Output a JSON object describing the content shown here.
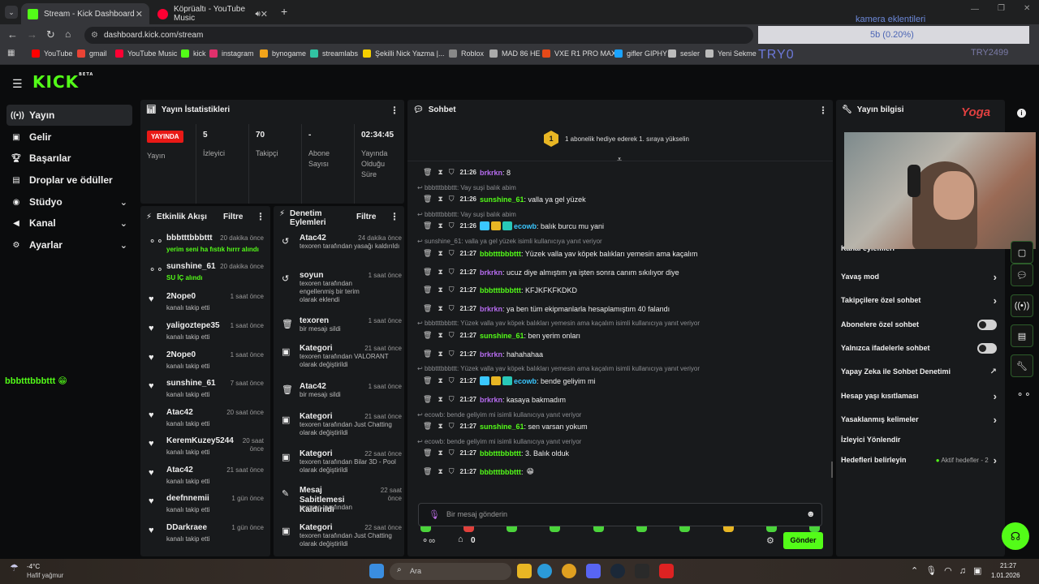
{
  "browser": {
    "tabs": [
      {
        "title": "Stream - Kick Dashboard"
      },
      {
        "title": "Köprüaltı - YouTube Music"
      }
    ],
    "new_tab": "+",
    "url": "dashboard.kick.com/stream",
    "bookmarks": [
      "YouTube",
      "gmail",
      "YouTube Music",
      "kick",
      "instagram",
      "bynogame",
      "streamlabs",
      "Şekilli Nick Yazma |...",
      "Roblox",
      "MAD 86 HE",
      "VXE R1 PRO MAX",
      "gifler GIPHY",
      "sesler",
      "Yeni Sekme"
    ]
  },
  "overlay": {
    "title": "kamera eklentileri",
    "value": "5b (0.20%)",
    "tag": "TRY0",
    "right_text": "TRY2499"
  },
  "sidebar": {
    "logo": "KICK",
    "logo_beta": "BETA",
    "items": [
      {
        "label": "Yayın"
      },
      {
        "label": "Gelir"
      },
      {
        "label": "Başarılar"
      },
      {
        "label": "Droplar ve ödüller"
      },
      {
        "label": "Stüdyo"
      },
      {
        "label": "Kanal"
      },
      {
        "label": "Ayarlar"
      }
    ],
    "floating_user": "bbbtttbbbttt"
  },
  "stats": {
    "title": "Yayın İstatistikleri",
    "live_badge": "YAYINDA",
    "live_label": "Yayın",
    "viewers": "5",
    "viewers_label": "İzleyici",
    "followers": "70",
    "followers_label": "Takipçi",
    "subs": "-",
    "subs_label": "Abone Sayısı",
    "uptime": "02:34:45",
    "uptime_label": "Yayında Olduğu Süre"
  },
  "activity": {
    "title": "Etkinlik Akışı",
    "filter": "Filtre",
    "rows": [
      {
        "name": "bbbtttbbbttt",
        "sub": "yerim seni ha fıstık hırrr alındı",
        "time": "20 dakika önce"
      },
      {
        "name": "sunshine_61",
        "sub": "SU İÇ alındı",
        "time": "20 dakika önce"
      },
      {
        "name": "2Nope0",
        "sub": "kanalı takip etti",
        "time": "1 saat önce"
      },
      {
        "name": "yaligoztepe35",
        "sub": "kanalı takip etti",
        "time": "1 saat önce"
      },
      {
        "name": "2Nope0",
        "sub": "kanalı takip etti",
        "time": "1 saat önce"
      },
      {
        "name": "sunshine_61",
        "sub": "kanalı takip etti",
        "time": "7 saat önce"
      },
      {
        "name": "Atac42",
        "sub": "kanalı takip etti",
        "time": "20 saat önce"
      },
      {
        "name": "KeremKuzey5244",
        "sub": "kanalı takip etti",
        "time": "20 saat önce"
      },
      {
        "name": "Atac42",
        "sub": "kanalı takip etti",
        "time": "21 saat önce"
      },
      {
        "name": "deefnnemii",
        "sub": "kanalı takip etti",
        "time": "1 gün önce"
      },
      {
        "name": "DDarkraee",
        "sub": "kanalı takip etti",
        "time": "1 gün önce"
      }
    ]
  },
  "moderation": {
    "title": "Denetim Eylemleri",
    "filter": "Filtre",
    "rows": [
      {
        "name": "Atac42",
        "time": "24 dakika önce",
        "sub": "texoren tarafından yasağı kaldırıldı"
      },
      {
        "name": "soyun",
        "time": "1 saat önce",
        "sub": "texoren tarafından engellenmiş bir terim olarak eklendi"
      },
      {
        "name": "texoren",
        "time": "1 saat önce",
        "sub": "bir mesajı sildi"
      },
      {
        "name": "Kategori",
        "time": "21 saat önce",
        "sub": "texoren tarafından VALORANT olarak değiştirildi"
      },
      {
        "name": "Atac42",
        "time": "1 saat önce",
        "sub": "bir mesajı sildi"
      },
      {
        "name": "Kategori",
        "time": "21 saat önce",
        "sub": "texoren tarafından Just Chatting olarak değiştirildi"
      },
      {
        "name": "Kategori",
        "time": "22 saat önce",
        "sub": "texoren tarafından Bilar 3D - Pool olarak değiştirildi"
      },
      {
        "name": "Mesaj Sabitlemesi Kaldırıldı",
        "time": "22 saat önce",
        "sub": "texoren tarafından"
      },
      {
        "name": "Kategori",
        "time": "22 saat önce",
        "sub": "texoren tarafından Just Chatting olarak değiştirildi"
      }
    ]
  },
  "chat": {
    "title": "Sohbet",
    "gift_text": "1 abonelik hediye ederek 1. sıraya yükselin",
    "gift_rank": "1",
    "replies": [
      "bbbtttbbbttt: Vay suşi balık abim",
      "bbbtttbbbttt: Vay suşi balık abim",
      "sunshine_61: valla ya gel yüzek isimli kullanıcıya yanıt veriyor",
      "bbbtttbbbttt: Yüzek valla yav köpek balıkları yemesin ama kaçalım isimli kullanıcıya yanıt veriyor",
      "bbbtttbbbttt: Yüzek valla yav köpek balıkları yemesin ama kaçalım isimli kullanıcıya yanıt veriyor",
      "ecowb: bende geliyim mi isimli kullanıcıya yanıt veriyor",
      "ecowb: bende geliyim mi isimli kullanıcıya yanıt veriyor"
    ],
    "reply_suffix": "isimli kullanıcıya yanıt veriyor",
    "messages": [
      {
        "time": "21:26",
        "user": "brkrkn",
        "text": ": 8"
      },
      {
        "time": "21:26",
        "user": "sunshine_61",
        "text": ": valla ya gel yüzek"
      },
      {
        "time": "21:26",
        "user": "ecowb",
        "text": ": balık burcu mu yani"
      },
      {
        "time": "21:27",
        "user": "bbbtttbbbttt",
        "text": ": Yüzek valla yav köpek balıkları yemesin ama kaçalım"
      },
      {
        "time": "21:27",
        "user": "brkrkn",
        "text": ": ucuz diye almıştım ya işten sonra canım sıkılıyor diye"
      },
      {
        "time": "21:27",
        "user": "bbbtttbbbttt",
        "text": ": KFJKFKFKDKD"
      },
      {
        "time": "21:27",
        "user": "brkrkn",
        "text": ": ya ben tüm ekipmanlarla hesaplamıştım 40 falandı"
      },
      {
        "time": "21:27",
        "user": "sunshine_61",
        "text": ": ben yerim onları"
      },
      {
        "time": "21:27",
        "user": "brkrkn",
        "text": ": hahahahaa"
      },
      {
        "time": "21:27",
        "user": "ecowb",
        "text": ": bende geliyim mi"
      },
      {
        "time": "21:27",
        "user": "brkrkn",
        "text": ": kasaya bakmadım"
      },
      {
        "time": "21:27",
        "user": "sunshine_61",
        "text": ": sen varsan yokum"
      },
      {
        "time": "21:27",
        "user": "bbbtttbbbttt",
        "text": ": 3. Balık olduk"
      },
      {
        "time": "21:27",
        "user": "bbbtttbbbttt",
        "text": ":"
      }
    ],
    "input_placeholder": "Bir mesaj gönderin",
    "points": "0",
    "send_label": "Gönder"
  },
  "info": {
    "title": "Yayın bilgisi",
    "channel_actions": "Kanal eylemleri",
    "settings": [
      {
        "label": "Yavaş mod",
        "control": "arrow"
      },
      {
        "label": "Takipçilere özel sohbet",
        "control": "arrow"
      },
      {
        "label": "Abonelere özel sohbet",
        "control": "toggle"
      },
      {
        "label": "Yalnızca ifadelerle sohbet",
        "control": "toggle"
      },
      {
        "label": "Yapay Zeka ile Sohbet Denetimi",
        "control": "external"
      },
      {
        "label": "Hesap yaşı kısıtlaması",
        "control": "arrow"
      },
      {
        "label": "Yasaklanmış kelimeler",
        "control": "arrow"
      },
      {
        "label": "İzleyici Yönlendir",
        "control": "none"
      },
      {
        "label": "Hedefleri belirleyin",
        "control": "arrow"
      }
    ],
    "goals_status": "Aktif hedefler - 2",
    "cam_text": "Yoga"
  },
  "taskbar": {
    "weather_temp": "-4°C",
    "weather_desc": "Hafif yağmur",
    "search": "Ara",
    "time": "21:27",
    "date": "1.01.2026"
  },
  "colors": {
    "kick_green": "#53fc18",
    "live_red": "#e91916",
    "panel": "#181a1c"
  }
}
